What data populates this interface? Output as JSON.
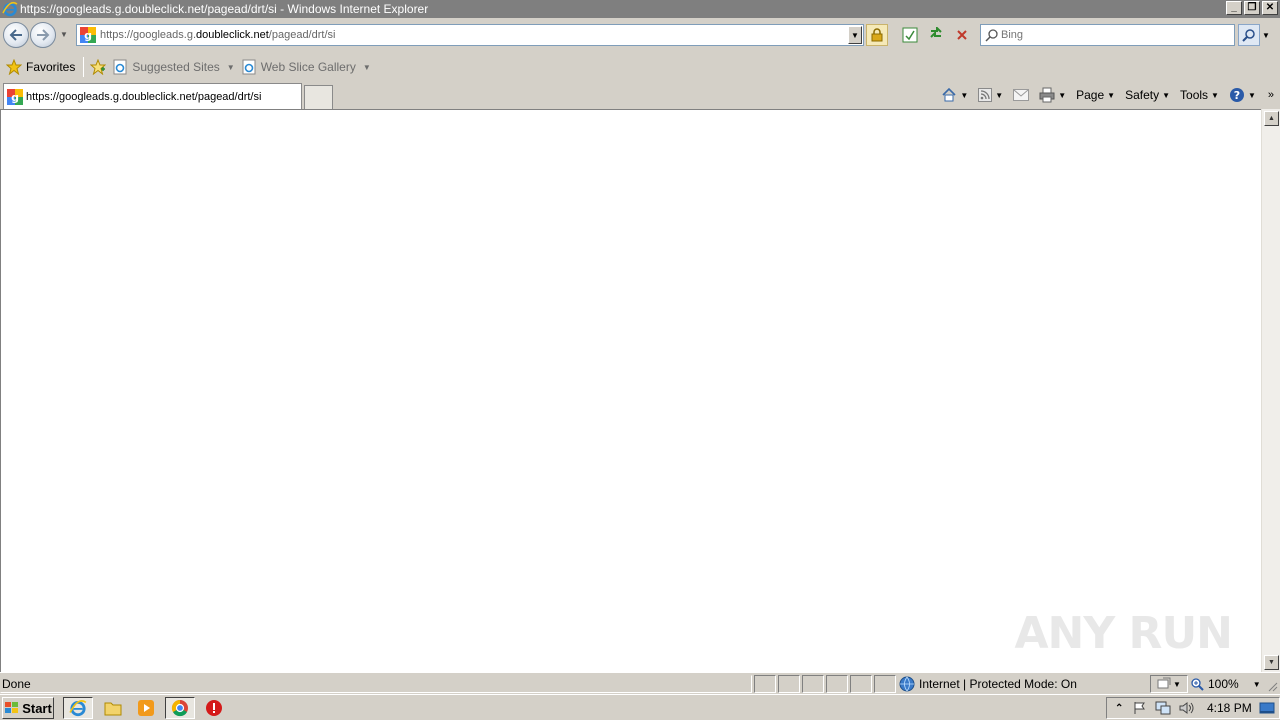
{
  "window": {
    "title": "https://googleads.g.doubleclick.net/pagead/drt/si - Windows Internet Explorer",
    "buttons": {
      "minimize": "_",
      "restore": "❐",
      "close": "✕"
    }
  },
  "navbar": {
    "url_scheme": "https://googleads.g.",
    "url_domain": "doubleclick.net",
    "url_path": "/pagead/drt/si",
    "search_placeholder": "Bing"
  },
  "favorites_bar": {
    "favorites_label": "Favorites",
    "items": [
      {
        "label": "Suggested Sites"
      },
      {
        "label": "Web Slice Gallery"
      }
    ]
  },
  "tabs": [
    {
      "label": "https://googleads.g.doubleclick.net/pagead/drt/si",
      "active": true
    }
  ],
  "command_bar": {
    "page_label": "Page",
    "safety_label": "Safety",
    "tools_label": "Tools"
  },
  "statusbar": {
    "status_text": "Done",
    "zone_text": "Internet | Protected Mode: On",
    "zoom_text": "100%"
  },
  "watermark": {
    "text": "ANY RUN"
  },
  "taskbar": {
    "start_label": "Start",
    "clock": "4:18 PM"
  },
  "colors": {
    "chrome_gray": "#d4d0c8",
    "titlebar": "#7f7f7f",
    "address_border": "#7f9db9"
  }
}
